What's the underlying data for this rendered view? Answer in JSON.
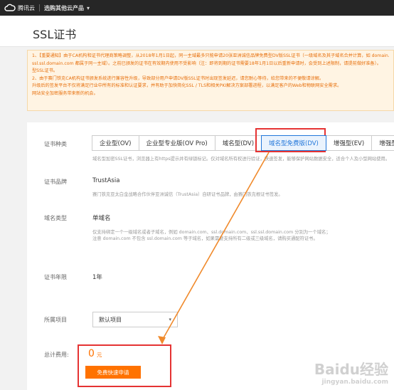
{
  "topbar": {
    "brand": "腾讯云",
    "products": "选购其他云产品"
  },
  "page": {
    "title": "SSL证书"
  },
  "notice": [
    "1、【重要通知】由于CA机构和证书代理商策略调整，从2018年1月1日起，同一主域最多只能申请20张亚洲诚信品牌免费型DV版SSL证书（一级域名及其子域名合并计算，如 domain.com 、ssl.domain.com 、",
    "ssl.ssl.domain.com 都属于同一主域）。之前已颁发的证书在有效期内使用不受影响（注：即将到期的证书需要18年1月1日以后重新申请时，会受到上述限制，请提前做好准备）。",
    "型SSL证书。",
    "2、由于赛门铁克CA机构证书颁发系统进行兼容性升级，导致部分用户申请DV版SSL证书时出现签发延迟，请您耐心等待，给您带来的不便敬请谅解。",
    "升级后的签发平台不仅将满足行业中所有的标准和认证要求，并有助于加快简化SSL / TLS和相关PKI解决方案部署进程，以满足客户的Web和物联网安全需求。",
    "网站安全加密服务带来新的机会。"
  ],
  "form": {
    "cert_type": {
      "label": "证书种类",
      "tabs": [
        "企业型(OV)",
        "企业型专业版(OV Pro)",
        "域名型(DV)",
        "域名型免费版(DV)",
        "增强型(EV)",
        "增强型专"
      ],
      "active_index": 3,
      "hint": "域名型加密SSL证书，浏览器上有https提示并有绿锁标记。仅对域名所有权进行验证，快速签发，能够保护网站数据安全，适合个人及小型网站使用。"
    },
    "brand": {
      "label": "证书品牌",
      "value": "TrustAsia",
      "hint": "赛门铁克亚太白金战略合作伙伴亚洲诚信（TrustAsia）自研证书品牌，由赛门铁克根证书签发。"
    },
    "domain_type": {
      "label": "域名类型",
      "value": "单域名",
      "hint1": "仅支持绑定一个一级域名或者子域名，例如 domain.com、ssl.domain.com、ssl.ssl.domain.com 分别为一个域名；",
      "hint2": "注意 domain.com 不包含 ssl.domain.com 等子域名，如果需要支持所有二级或三级域名，请购买通配符证书。"
    },
    "years": {
      "label": "证书年限",
      "value": "1年"
    },
    "project": {
      "label": "所属项目",
      "value": "默认项目"
    },
    "total": {
      "label": "总计费用:",
      "amount": "0",
      "unit": "元"
    },
    "buy_label": "免费快速申请"
  },
  "watermark": {
    "main": "Baidu经验",
    "sub": "jingyan.baidu.com"
  },
  "colors": {
    "accent_orange": "#ff7200",
    "highlight_red": "#e53333",
    "active_blue": "#2277da",
    "topbar": "#262626"
  }
}
